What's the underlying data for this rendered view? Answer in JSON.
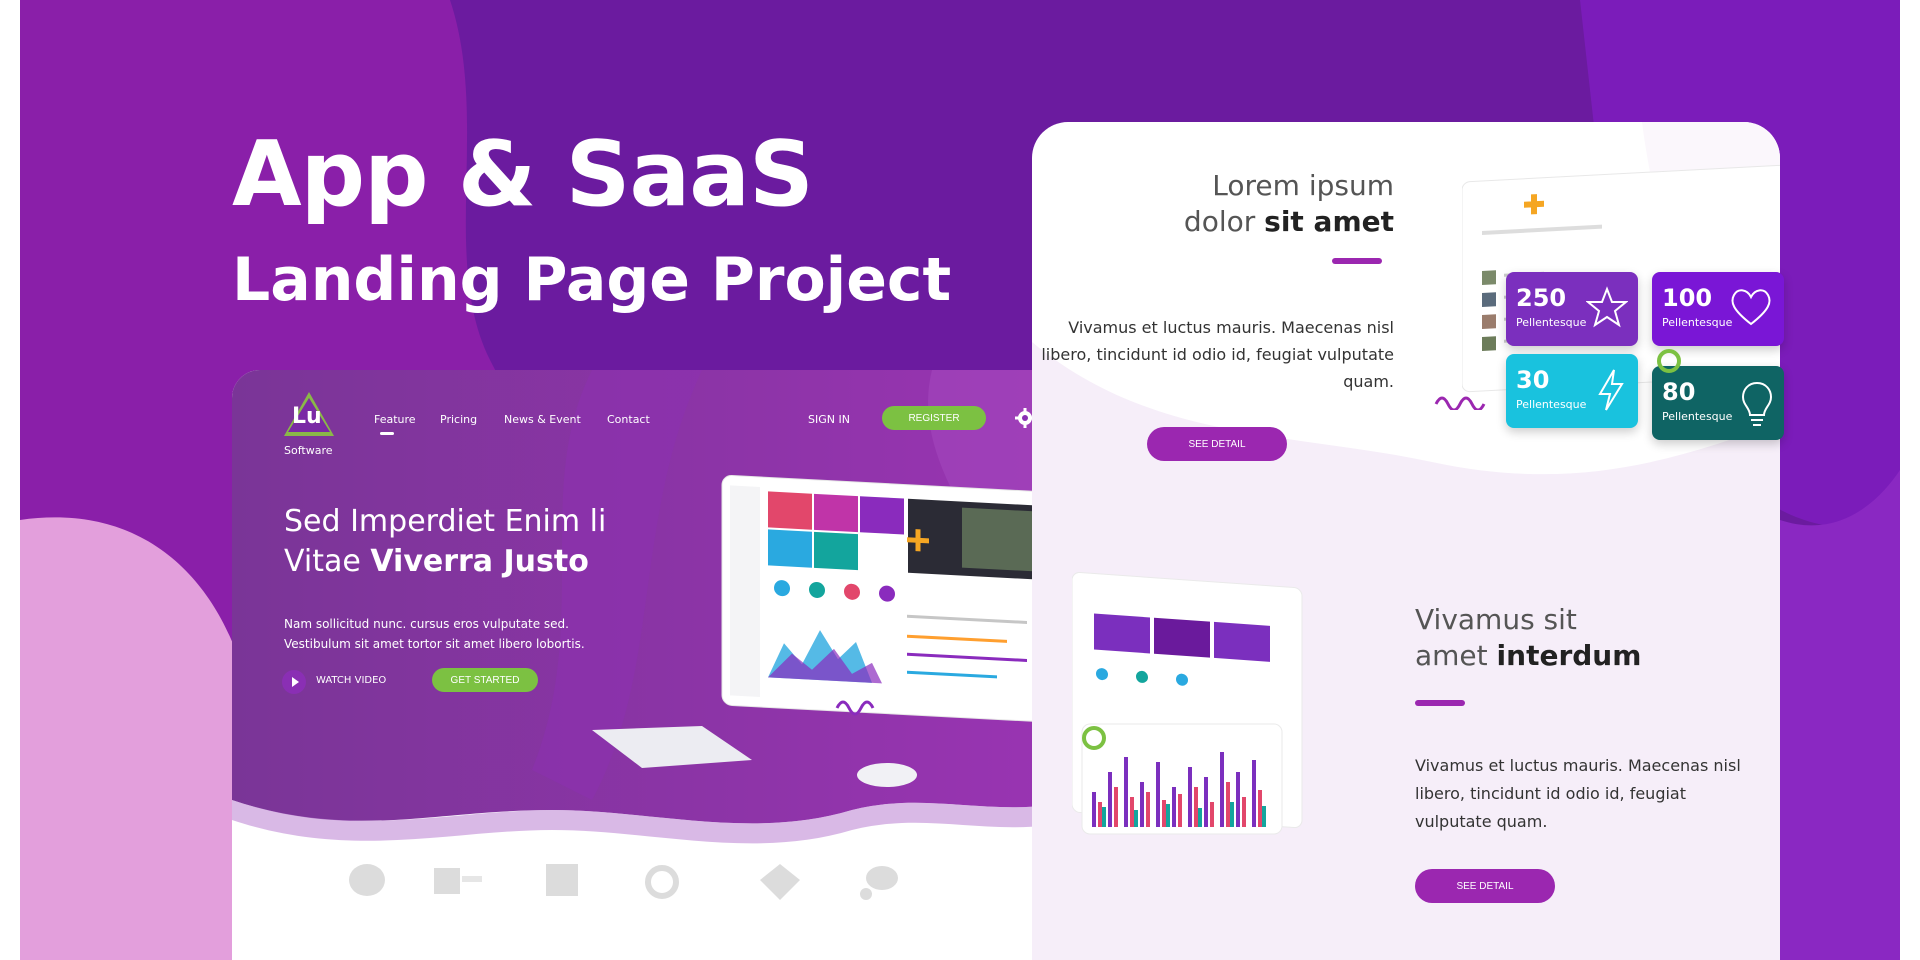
{
  "hero": {
    "title": "App & SaaS",
    "subtitle": "Landing Page Project"
  },
  "left_mockup": {
    "logo_text": "Lu",
    "logo_sub": "Software",
    "nav": [
      "Feature",
      "Pricing",
      "News & Event",
      "Contact"
    ],
    "sign_in": "SIGN IN",
    "register": "REGISTER",
    "headline_line1": "Sed Imperdiet Enim li",
    "headline_line2_plain": "Vitae ",
    "headline_line2_bold": "Viverra Justo",
    "paragraph": "Nam sollicitud nunc. cursus eros vulputate sed. Vestibulum sit amet tortor sit amet libero lobortis.",
    "watch_video": "WATCH VIDEO",
    "get_started": "GET STARTED",
    "gear_icon": "gear-icon",
    "play_icon": "play-icon"
  },
  "right_mockup": {
    "section1": {
      "heading_line1": "Lorem ipsum",
      "heading_line2_plain": "dolor ",
      "heading_line2_bold": "sit amet",
      "paragraph": "Vivamus et luctus mauris. Maecenas nisl libero, tincidunt id odio id, feugiat vulputate quam.",
      "button": "SEE DETAIL"
    },
    "section2": {
      "heading_line1": "Vivamus sit",
      "heading_line2_plain": "amet ",
      "heading_line2_bold": "interdum",
      "paragraph": "Vivamus et luctus mauris. Maecenas nisl libero, tincidunt id odio id, feugiat vulputate quam.",
      "button": "SEE DETAIL"
    }
  },
  "stats": [
    {
      "value": "250",
      "label": "Pellentesque",
      "icon": "star-icon",
      "color": "#7b2fbe"
    },
    {
      "value": "100",
      "label": "Pellentesque",
      "icon": "heart-icon",
      "color": "#7a16d6"
    },
    {
      "value": "30",
      "label": "Pellentesque",
      "icon": "lightning-icon",
      "color": "#19c2de"
    },
    {
      "value": "80",
      "label": "Pellentesque",
      "icon": "lightbulb-icon",
      "color": "#0f6464"
    }
  ],
  "colors": {
    "background": "#6a1a9c",
    "accent_purple": "#9b27b0",
    "accent_green": "#7cc142"
  }
}
